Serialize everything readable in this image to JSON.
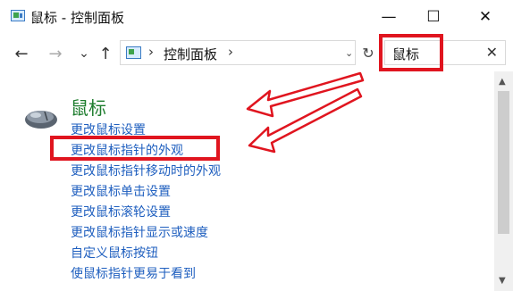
{
  "window": {
    "title": "鼠标 - 控制面板",
    "icon": "control-panel-icon"
  },
  "window_controls": {
    "minimize": "—",
    "maximize": "☐",
    "close": "✕"
  },
  "nav": {
    "back": "←",
    "forward": "→",
    "recent": "⌄",
    "up": "↑"
  },
  "address": {
    "separator": "›",
    "path": "控制面板",
    "dropdown": "⌄",
    "refresh": "↻"
  },
  "search": {
    "value": "鼠标",
    "clear": "✕"
  },
  "section": {
    "heading": "鼠标",
    "icon": "mouse-icon",
    "links": [
      "更改鼠标设置",
      "更改鼠标指针的外观",
      "更改鼠标指针移动时的外观",
      "更改鼠标单击设置",
      "更改鼠标滚轮设置",
      "更改鼠标指针显示或速度",
      "自定义鼠标按钮",
      "使鼠标指针更易于看到"
    ]
  },
  "annotations": {
    "color": "#e0151f"
  },
  "colors": {
    "heading": "#1e7d2e",
    "link": "#1f5fbf"
  }
}
